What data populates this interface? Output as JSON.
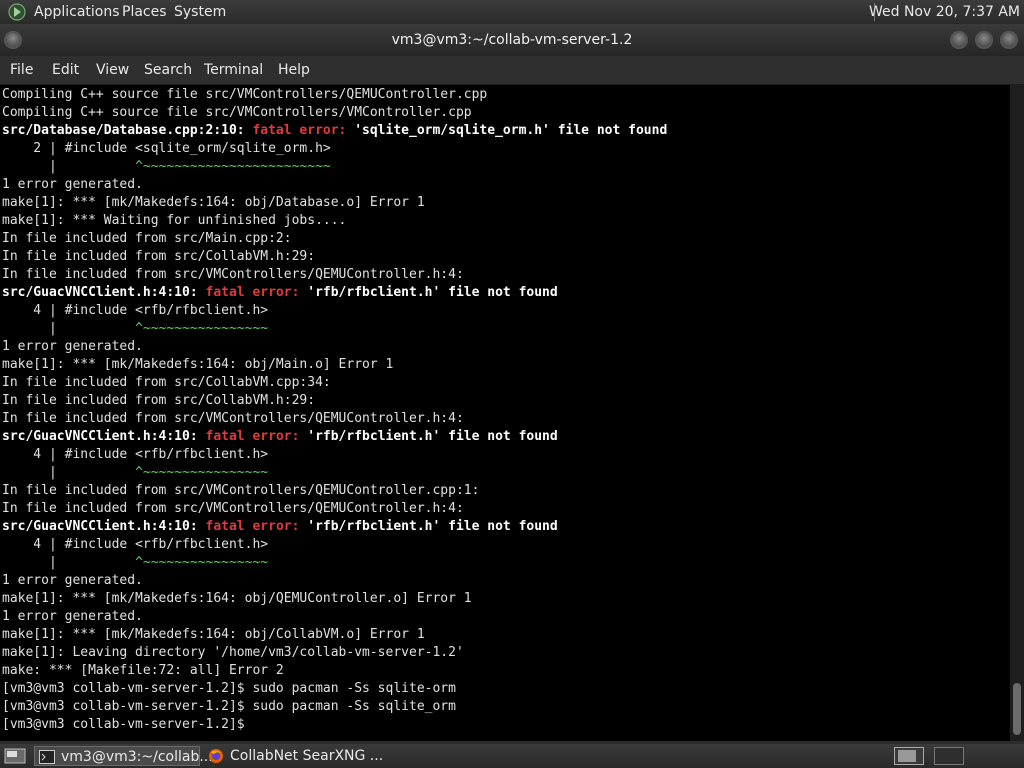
{
  "top_panel": {
    "applications": "Applications",
    "places": "Places",
    "system": "System",
    "clock": "Wed Nov 20,  7:37 AM"
  },
  "window": {
    "title": "vm3@vm3:~/collab-vm-server-1.2"
  },
  "menubar": {
    "file": "File",
    "edit": "Edit",
    "view": "View",
    "search": "Search",
    "terminal": "Terminal",
    "help": "Help"
  },
  "terminal_lines": [
    [
      {
        "t": "Compiling C++ source file src/VMControllers/QEMUController.cpp"
      }
    ],
    [
      {
        "t": "Compiling C++ source file src/VMControllers/VMController.cpp"
      }
    ],
    [
      {
        "t": "src/Database/Database.cpp:2:10: ",
        "s": "b"
      },
      {
        "t": "fatal error: ",
        "s": "r"
      },
      {
        "t": "'sqlite_orm/sqlite_orm.h' file not found",
        "s": "b"
      }
    ],
    [
      {
        "t": "    2 | #include <sqlite_orm/sqlite_orm.h>"
      }
    ],
    [
      {
        "t": "      |          "
      },
      {
        "t": "^~~~~~~~~~~~~~~~~~~~~~~~~",
        "s": "g"
      }
    ],
    [
      {
        "t": "1 error generated."
      }
    ],
    [
      {
        "t": "make[1]: *** [mk/Makedefs:164: obj/Database.o] Error 1"
      }
    ],
    [
      {
        "t": "make[1]: *** Waiting for unfinished jobs...."
      }
    ],
    [
      {
        "t": "In file included from src/Main.cpp:2:"
      }
    ],
    [
      {
        "t": "In file included from src/CollabVM.h:29:"
      }
    ],
    [
      {
        "t": "In file included from src/VMControllers/QEMUController.h:4:"
      }
    ],
    [
      {
        "t": "src/GuacVNCClient.h:4:10: ",
        "s": "b"
      },
      {
        "t": "fatal error: ",
        "s": "r"
      },
      {
        "t": "'rfb/rfbclient.h' file not found",
        "s": "b"
      }
    ],
    [
      {
        "t": "    4 | #include <rfb/rfbclient.h>"
      }
    ],
    [
      {
        "t": "      |          "
      },
      {
        "t": "^~~~~~~~~~~~~~~~~",
        "s": "g"
      }
    ],
    [
      {
        "t": "1 error generated."
      }
    ],
    [
      {
        "t": "make[1]: *** [mk/Makedefs:164: obj/Main.o] Error 1"
      }
    ],
    [
      {
        "t": "In file included from src/CollabVM.cpp:34:"
      }
    ],
    [
      {
        "t": "In file included from src/CollabVM.h:29:"
      }
    ],
    [
      {
        "t": "In file included from src/VMControllers/QEMUController.h:4:"
      }
    ],
    [
      {
        "t": "src/GuacVNCClient.h:4:10: ",
        "s": "b"
      },
      {
        "t": "fatal error: ",
        "s": "r"
      },
      {
        "t": "'rfb/rfbclient.h' file not found",
        "s": "b"
      }
    ],
    [
      {
        "t": "    4 | #include <rfb/rfbclient.h>"
      }
    ],
    [
      {
        "t": "      |          "
      },
      {
        "t": "^~~~~~~~~~~~~~~~~",
        "s": "g"
      }
    ],
    [
      {
        "t": "In file included from src/VMControllers/QEMUController.cpp:1:"
      }
    ],
    [
      {
        "t": "In file included from src/VMControllers/QEMUController.h:4:"
      }
    ],
    [
      {
        "t": "src/GuacVNCClient.h:4:10: ",
        "s": "b"
      },
      {
        "t": "fatal error: ",
        "s": "r"
      },
      {
        "t": "'rfb/rfbclient.h' file not found",
        "s": "b"
      }
    ],
    [
      {
        "t": "    4 | #include <rfb/rfbclient.h>"
      }
    ],
    [
      {
        "t": "      |          "
      },
      {
        "t": "^~~~~~~~~~~~~~~~~",
        "s": "g"
      }
    ],
    [
      {
        "t": "1 error generated."
      }
    ],
    [
      {
        "t": "make[1]: *** [mk/Makedefs:164: obj/QEMUController.o] Error 1"
      }
    ],
    [
      {
        "t": "1 error generated."
      }
    ],
    [
      {
        "t": "make[1]: *** [mk/Makedefs:164: obj/CollabVM.o] Error 1"
      }
    ],
    [
      {
        "t": "make[1]: Leaving directory '/home/vm3/collab-vm-server-1.2'"
      }
    ],
    [
      {
        "t": "make: *** [Makefile:72: all] Error 2"
      }
    ],
    [
      {
        "t": "[vm3@vm3 collab-vm-server-1.2]$ sudo pacman -Ss sqlite-orm"
      }
    ],
    [
      {
        "t": "[vm3@vm3 collab-vm-server-1.2]$ sudo pacman -Ss sqlite_orm"
      }
    ],
    [
      {
        "t": "[vm3@vm3 collab-vm-server-1.2]$ "
      }
    ]
  ],
  "taskbar": {
    "task1_label": "vm3@vm3:~/collab...",
    "task2_label": "CollabNet SearXNG ..."
  }
}
